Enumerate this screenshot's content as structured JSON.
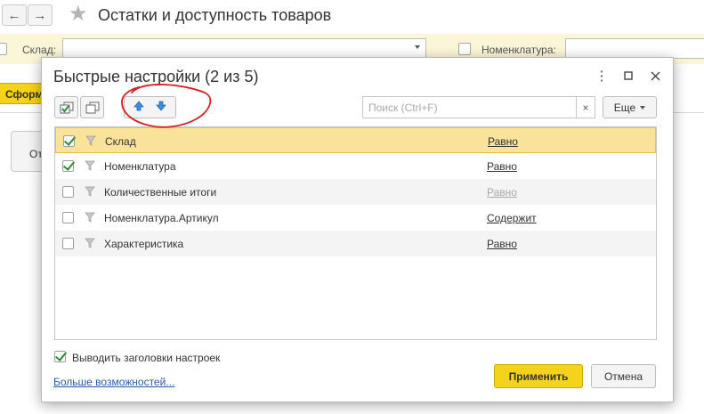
{
  "main_form": {
    "title": "Остатки и доступность товаров",
    "nav": {
      "back_glyph": "←",
      "forward_glyph": "→"
    },
    "filters": {
      "warehouse_label": "Склад:",
      "warehouse_value": "",
      "nomenclature_label": "Номенклатура:",
      "nomenclature_value": ""
    },
    "primary_button_label": "Сформ",
    "tab_label": "От"
  },
  "dialog": {
    "title": "Быстрые настройки (2 из 5)",
    "search_placeholder": "Поиск (Ctrl+F)",
    "search_clear": "×",
    "more_label": "Еще",
    "settings": [
      {
        "label": "Склад",
        "condition": "Равно",
        "checked": true,
        "selected": true,
        "condition_enabled": true
      },
      {
        "label": "Номенклатура",
        "condition": "Равно",
        "checked": true,
        "selected": false,
        "condition_enabled": true
      },
      {
        "label": "Количественные итоги",
        "condition": "Равно",
        "checked": false,
        "selected": false,
        "condition_enabled": false
      },
      {
        "label": "Номенклатура.Артикул",
        "condition": "Содержит",
        "checked": false,
        "selected": false,
        "condition_enabled": true
      },
      {
        "label": "Характеристика",
        "condition": "Равно",
        "checked": false,
        "selected": false,
        "condition_enabled": true
      }
    ],
    "show_headers_label": "Выводить заголовки настроек",
    "show_headers_checked": true,
    "more_options_link": "Больше возможностей...",
    "apply_label": "Применить",
    "cancel_label": "Отмена"
  },
  "colors": {
    "accent_yellow": "#f5d21b",
    "filter_bar": "#fcf6d9",
    "selected_row": "#f9e39b",
    "link_blue": "#2d5ba4",
    "check_green": "#2e8b3a",
    "arrow_blue": "#3a8fd8",
    "annotation_red": "#d42020"
  }
}
